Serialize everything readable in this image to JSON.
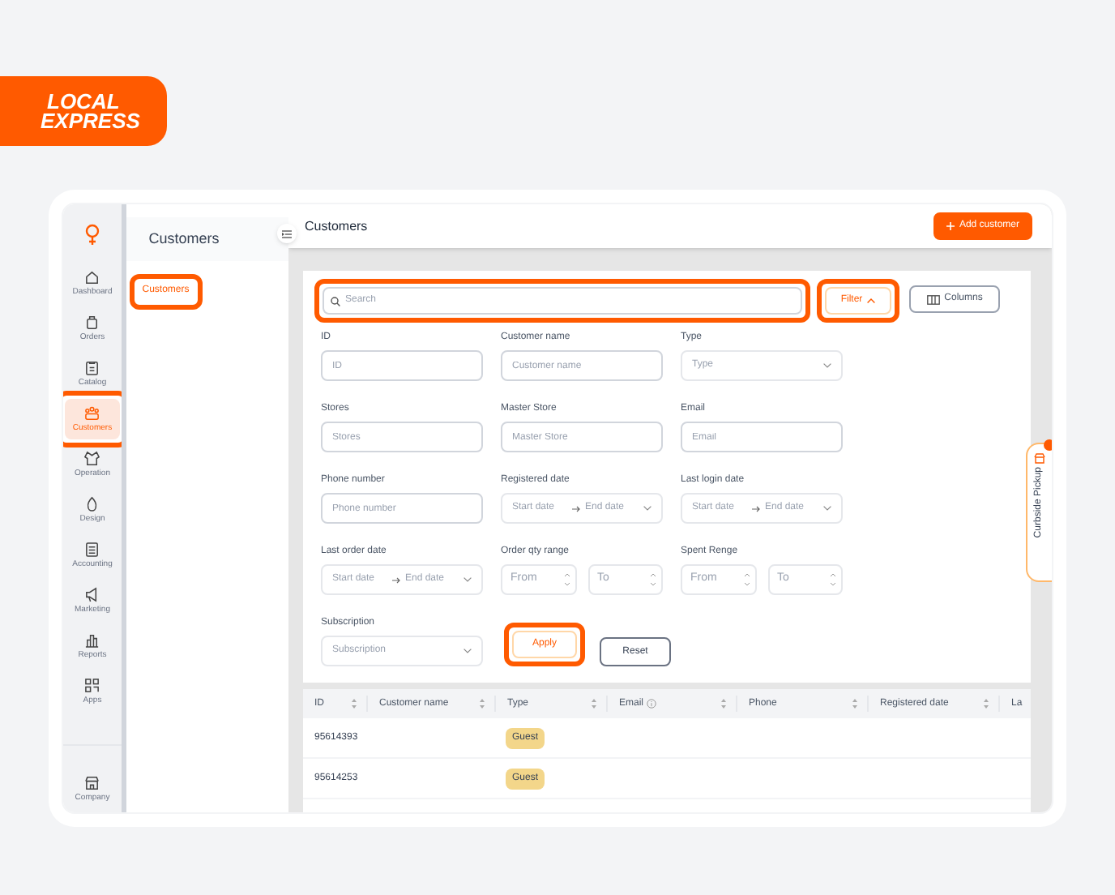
{
  "brand": {
    "line1": "LOCAL",
    "line2": "EXPRESS"
  },
  "rail": {
    "items": [
      {
        "label": "Dashboard",
        "selected": false,
        "highlighted": false
      },
      {
        "label": "Orders",
        "selected": false,
        "highlighted": false
      },
      {
        "label": "Catalog",
        "selected": false,
        "highlighted": false
      },
      {
        "label": "Customers",
        "selected": true,
        "highlighted": true
      },
      {
        "label": "Operation",
        "selected": false,
        "highlighted": false
      },
      {
        "label": "Design",
        "selected": false,
        "highlighted": false
      },
      {
        "label": "Accounting",
        "selected": false,
        "highlighted": false
      },
      {
        "label": "Marketing",
        "selected": false,
        "highlighted": false
      },
      {
        "label": "Reports",
        "selected": false,
        "highlighted": false
      },
      {
        "label": "Apps",
        "selected": false,
        "highlighted": false
      }
    ],
    "footer": {
      "label": "Company"
    }
  },
  "submenu": {
    "title": "Customers",
    "items": [
      {
        "label": "Customers",
        "selected": true,
        "highlighted": true
      }
    ]
  },
  "header": {
    "title": "Customers",
    "add_button": "Add customer"
  },
  "search": {
    "placeholder": "Search",
    "highlighted": true
  },
  "filter_button": {
    "label": "Filter",
    "expanded": true,
    "highlighted": true
  },
  "columns_button": {
    "label": "Columns"
  },
  "filters": [
    {
      "label": "ID",
      "kind": "text",
      "placeholder": "ID"
    },
    {
      "label": "Customer name",
      "kind": "text",
      "placeholder": "Customer name"
    },
    {
      "label": "Type",
      "kind": "select",
      "placeholder": "Type"
    },
    {
      "label": "Stores",
      "kind": "text",
      "placeholder": "Stores"
    },
    {
      "label": "Master Store",
      "kind": "text",
      "placeholder": "Master Store"
    },
    {
      "label": "Email",
      "kind": "text",
      "placeholder": "Email"
    },
    {
      "label": "Phone number",
      "kind": "text",
      "placeholder": "Phone number"
    },
    {
      "label": "Registered date",
      "kind": "daterange",
      "start": "Start date",
      "end": "End date"
    },
    {
      "label": "Last login date",
      "kind": "daterange",
      "start": "Start date",
      "end": "End date"
    },
    {
      "label": "Last order date",
      "kind": "daterange",
      "start": "Start date",
      "end": "End date"
    },
    {
      "label": "Order qty range",
      "kind": "range",
      "from": "From",
      "to": "To"
    },
    {
      "label": "Spent Renge",
      "kind": "range",
      "from": "From",
      "to": "To"
    }
  ],
  "subscription": {
    "label": "Subscription",
    "placeholder": "Subscription"
  },
  "apply_button": {
    "label": "Apply",
    "highlighted": true
  },
  "reset_button": {
    "label": "Reset"
  },
  "table": {
    "columns": [
      {
        "label": "ID",
        "sortable": true,
        "info": false
      },
      {
        "label": "Customer name",
        "sortable": true,
        "info": false
      },
      {
        "label": "Type",
        "sortable": true,
        "info": false
      },
      {
        "label": "Email",
        "sortable": true,
        "info": true
      },
      {
        "label": "Phone",
        "sortable": true,
        "info": false
      },
      {
        "label": "Registered date",
        "sortable": true,
        "info": false
      },
      {
        "label": "La",
        "sortable": false,
        "info": false
      }
    ],
    "rows": [
      {
        "id": "95614393",
        "type": "Guest"
      },
      {
        "id": "95614253",
        "type": "Guest"
      }
    ]
  },
  "curbside_tab": {
    "label": "Curbside Pickup"
  }
}
